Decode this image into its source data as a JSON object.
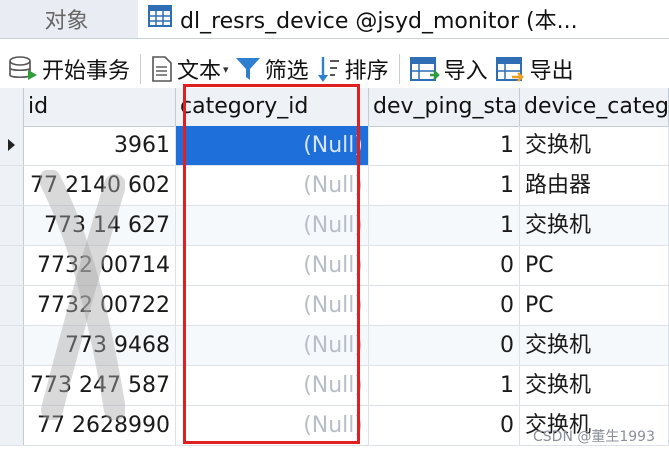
{
  "tabs": {
    "objects_label": "对象",
    "active_label": "dl_resrs_device @jsyd_monitor (本..."
  },
  "toolbar": {
    "begin_transaction": "开始事务",
    "text": "文本",
    "filter": "筛选",
    "sort": "排序",
    "import": "导入",
    "export": "导出"
  },
  "columns": [
    "id",
    "category_id",
    "dev_ping_sta",
    "device_categ"
  ],
  "rows": [
    {
      "id": "3961",
      "category_id": "(Null)",
      "dev_ping": "1",
      "device_category": "交换机"
    },
    {
      "id": "77 2140 602",
      "category_id": "(Null)",
      "dev_ping": "1",
      "device_category": "路由器"
    },
    {
      "id": "773 14 627",
      "category_id": "(Null)",
      "dev_ping": "1",
      "device_category": "交换机"
    },
    {
      "id": "7732 00714",
      "category_id": "(Null)",
      "dev_ping": "0",
      "device_category": "PC"
    },
    {
      "id": "7732 00722",
      "category_id": "(Null)",
      "dev_ping": "0",
      "device_category": "PC"
    },
    {
      "id": "773 9468",
      "category_id": "(Null)",
      "dev_ping": "0",
      "device_category": "交换机"
    },
    {
      "id": "773 247 587",
      "category_id": "(Null)",
      "dev_ping": "1",
      "device_category": "交换机"
    },
    {
      "id": "77 2628990",
      "category_id": "(Null)",
      "dev_ping": "0",
      "device_category": "交换机"
    }
  ],
  "watermark": "CSDN @董生1993",
  "colors": {
    "selection": "#1e6fd9",
    "highlight": "#e02020",
    "null_text": "#b8bec8"
  }
}
